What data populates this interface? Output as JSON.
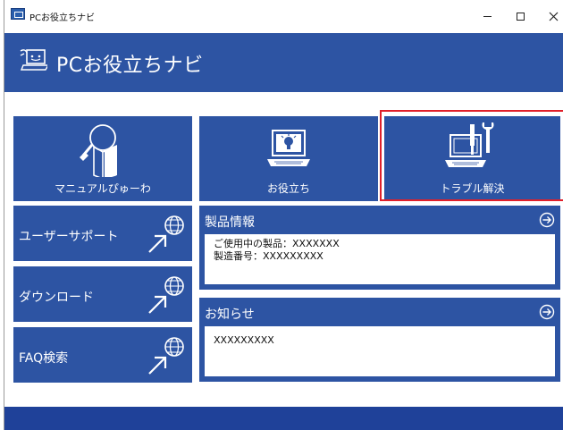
{
  "window": {
    "title": "PCお役立ちナビ",
    "controls": {
      "minimize": "–",
      "maximize": "□",
      "close": "✕"
    }
  },
  "header": {
    "app_title": "PCお役立ちナビ",
    "logo_icon": "pc-navi-logo-icon"
  },
  "tiles": {
    "manual": {
      "label": "マニュアルぴゅーわ",
      "icon": "manual-viewer-icon"
    },
    "help": {
      "label": "お役立ち",
      "icon": "lightbulb-laptop-icon"
    },
    "trouble": {
      "label": "トラブル解決",
      "icon": "tools-laptop-icon",
      "highlighted": true
    }
  },
  "side_links": [
    {
      "label": "ユーザーサポート",
      "icon": "globe-arrow-icon"
    },
    {
      "label": "ダウンロード",
      "icon": "globe-arrow-icon"
    },
    {
      "label": "FAQ検索",
      "icon": "globe-arrow-icon"
    }
  ],
  "product_info": {
    "title": "製品情報",
    "line1": "ご使用中の製品：XXXXXXX",
    "line2": "製造番号：XXXXXXXXX"
  },
  "news": {
    "title": "お知らせ",
    "text": "XXXXXXXXX"
  },
  "colors": {
    "tile_blue": "#2d54a3",
    "footer_blue": "#1f4199",
    "highlight_red": "#e0202a"
  }
}
